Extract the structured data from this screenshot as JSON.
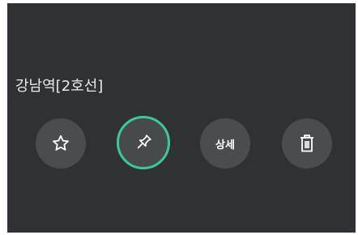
{
  "station": {
    "name": "강남역[2호선]"
  },
  "actions": [
    {
      "id": "favorite",
      "icon": "star-icon"
    },
    {
      "id": "pin",
      "icon": "pin-icon",
      "selected": true,
      "ring_color": "#3ec79a"
    },
    {
      "id": "detail",
      "label": "상세"
    },
    {
      "id": "delete",
      "icon": "trash-icon"
    }
  ],
  "colors": {
    "background": "#2f3134",
    "button_bg": "#4a4c50",
    "text": "#e8eaed",
    "accent": "#3ec79a"
  }
}
